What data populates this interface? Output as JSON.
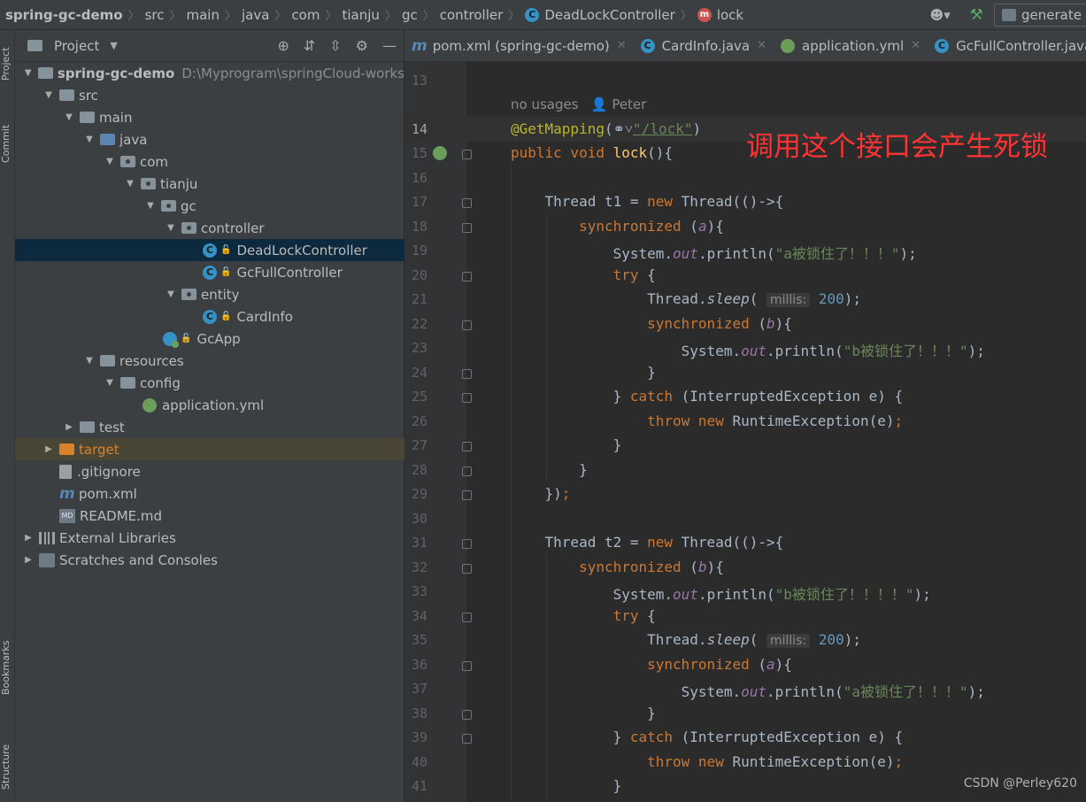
{
  "breadcrumb": {
    "project": "spring-gc-demo",
    "items": [
      "src",
      "main",
      "java",
      "com",
      "tianju",
      "gc",
      "controller"
    ],
    "class_name": "DeadLockController",
    "method": "lock"
  },
  "toolbar": {
    "run_config": "generate"
  },
  "side_tabs": {
    "project": "Project",
    "commit": "Commit",
    "bookmarks": "Bookmarks",
    "structure": "Structure"
  },
  "project_panel": {
    "title": "Project",
    "root_name": "spring-gc-demo",
    "root_path": "D:\\Myprogram\\springCloud-works",
    "tree": {
      "src": "src",
      "main": "main",
      "java": "java",
      "com": "com",
      "tianju": "tianju",
      "gc": "gc",
      "controller": "controller",
      "deadlock": "DeadLockController",
      "gcfull": "GcFullController",
      "entity": "entity",
      "cardinfo": "CardInfo",
      "gcapp": "GcApp",
      "resources": "resources",
      "config": "config",
      "appyml": "application.yml",
      "test": "test",
      "target": "target",
      "gitignore": ".gitignore",
      "pom": "pom.xml",
      "readme": "README.md",
      "extlibs": "External Libraries",
      "scratches": "Scratches and Consoles"
    }
  },
  "tabs": [
    "pom.xml (spring-gc-demo)",
    "CardInfo.java",
    "application.yml",
    "GcFullController.java"
  ],
  "editor": {
    "usages": "no usages",
    "author": "Peter",
    "hint_label": "millis:",
    "annotation_note": "调用这个接口会产生死锁",
    "lines": {
      "n13": "13",
      "n14": "14",
      "n15": "15",
      "n16": "16",
      "n17": "17",
      "n18": "18",
      "n19": "19",
      "n20": "20",
      "n21": "21",
      "n22": "22",
      "n23": "23",
      "n24": "24",
      "n25": "25",
      "n26": "26",
      "n27": "27",
      "n28": "28",
      "n29": "29",
      "n30": "30",
      "n31": "31",
      "n32": "32",
      "n33": "33",
      "n34": "34",
      "n35": "35",
      "n36": "36",
      "n37": "37",
      "n38": "38",
      "n39": "39",
      "n40": "40",
      "n41": "41"
    },
    "strings": {
      "lock_path": "\"/lock\"",
      "a_locked": "\"a被锁住了！！！\"",
      "b_locked": "\"b被锁住了！！！\"",
      "b_locked4": "\"b被锁住了！！！！\"",
      "sleep_ms": "200"
    }
  },
  "watermark": "CSDN @Perley620"
}
